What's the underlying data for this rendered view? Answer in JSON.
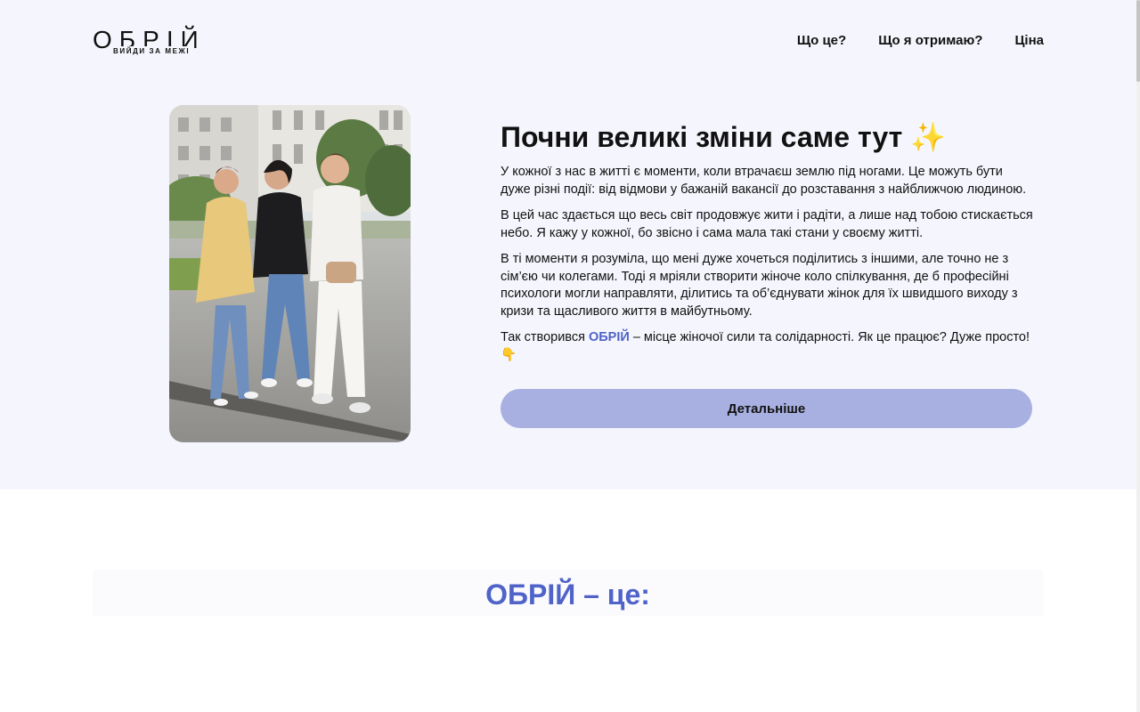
{
  "header": {
    "logo_text": "ОБРІЙ",
    "logo_tagline": "ВИЙДИ ЗА МЕЖІ",
    "nav": [
      {
        "label": "Що це?"
      },
      {
        "label": "Що я отримаю?"
      },
      {
        "label": "Ціна"
      }
    ]
  },
  "hero": {
    "title": "Почни великі зміни саме тут",
    "title_emoji": "✨",
    "paragraphs": [
      "У кожної з нас в житті є моменти, коли втрачаєш землю під ногами. Це можуть бути дуже різні події: від відмови у бажаній вакансії до розставання з найближчою людиною.",
      "В цей час здається що весь світ продовжує жити і радіти, а лише над тобою стискається небо. Я кажу у кожної, бо звісно і сама мала такі стани у своєму житті.",
      "В ті моменти я розуміла, що мені дуже хочеться поділитись з іншими, але точно не з сім’єю чи колегами. Тоді я мріяли створити жіноче коло спілкування, де б професійні психологи могли направляти, ділитись та об’єднувати жінок для їх швидшого виходу з кризи та щасливого життя в майбутньому."
    ],
    "last_paragraph": {
      "before": "Так створився ",
      "brand": "ОБРІЙ",
      "after": " – місце жіночої сили та солідарності. Як це працює? Дуже просто!",
      "emoji": "👇"
    },
    "cta_label": "Детальніше",
    "photo_icon": "group-photo-icon"
  },
  "section": {
    "title": "ОБРІЙ – це:"
  },
  "colors": {
    "hero_bg": "#f5f6fd",
    "accent": "#4f63c8",
    "button": "#a7b0e0"
  }
}
